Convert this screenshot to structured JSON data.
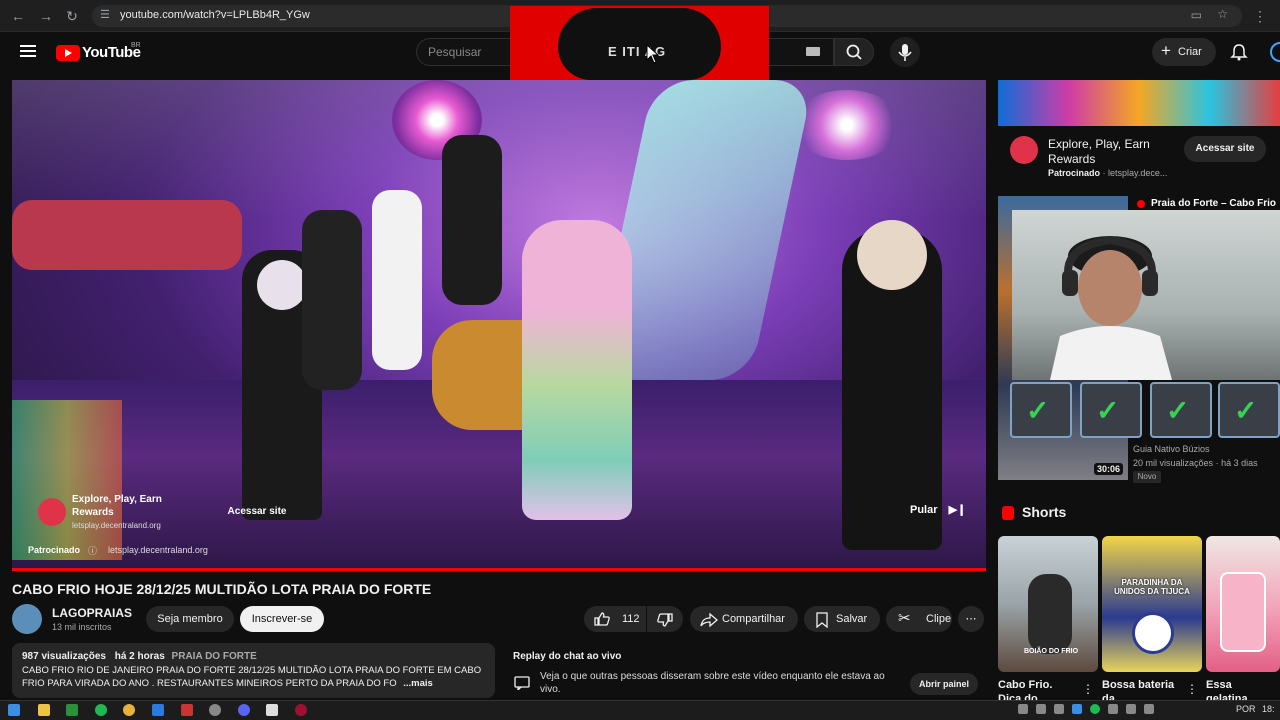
{
  "browser": {
    "url": "youtube.com/watch?v=LPLBb4R_YGw"
  },
  "header": {
    "logo_text": "YouTube",
    "logo_country": "BR",
    "search_placeholder": "Pesquisar",
    "create_label": "Criar",
    "banner_text": "E ITI AG"
  },
  "video": {
    "ad_card": {
      "title": "Explore, Play, Earn Rewards",
      "domain": "letsplay.decentraland.org",
      "button": "Acessar site"
    },
    "sponsored_label": "Patrocinado",
    "sponsored_domain": "letsplay.decentraland.org",
    "skip_label": "Pular",
    "progress": 1.0,
    "title": "CABO FRIO HOJE 28/12/25 MULTIDÃO LOTA PRAIA DO FORTE"
  },
  "channel": {
    "name": "LAGOPRAIAS",
    "subscribers": "13 mil inscritos",
    "join_label": "Seja membro",
    "subscribe_label": "Inscrever-se"
  },
  "actions": {
    "likes": "112",
    "share_label": "Compartilhar",
    "save_label": "Salvar",
    "clip_label": "Clipe"
  },
  "description": {
    "views": "987 visualizações",
    "time": "há 2 horas",
    "tag": "PRAIA DO FORTE",
    "text": "CABO FRIO RIO DE JANEIRO PRAIA DO FORTE 28/12/25 MULTIDÃO LOTA PRAIA DO FORTE EM CABO FRIO PARA VIRADA DO ANO . RESTAURANTES MINEIROS PERTO DA PRAIA DO FO",
    "more_label": "...mais"
  },
  "chat": {
    "title": "Replay do chat ao vivo",
    "text": "Veja o que outras pessoas disseram sobre este vídeo enquanto ele estava ao vivo.",
    "button": "Abrir painel"
  },
  "sidebar": {
    "ad": {
      "title": "Explore, Play, Earn Rewards",
      "sponsored": "Patrocinado",
      "domain": "letsplay.dece...",
      "button": "Acessar site"
    },
    "recommended": {
      "title": "Praia do Forte – Cabo Frio",
      "channel": "Guia Nativo Búzios",
      "views": "20 mil visualizações",
      "age": "há 3 dias",
      "badge": "Novo",
      "duration": "30:06"
    },
    "shorts_label": "Shorts",
    "shorts": [
      {
        "title": "Cabo Frio. Dica do",
        "thumb_text": "BOIÃO DO FRIO"
      },
      {
        "title": "Bossa bateria da",
        "thumb_text": "PARADINHA DA UNIDOS DA TIJUCA"
      },
      {
        "title": "Essa gelatina",
        "thumb_text": ""
      }
    ]
  },
  "taskbar": {
    "lang": "POR",
    "time": "18:"
  }
}
